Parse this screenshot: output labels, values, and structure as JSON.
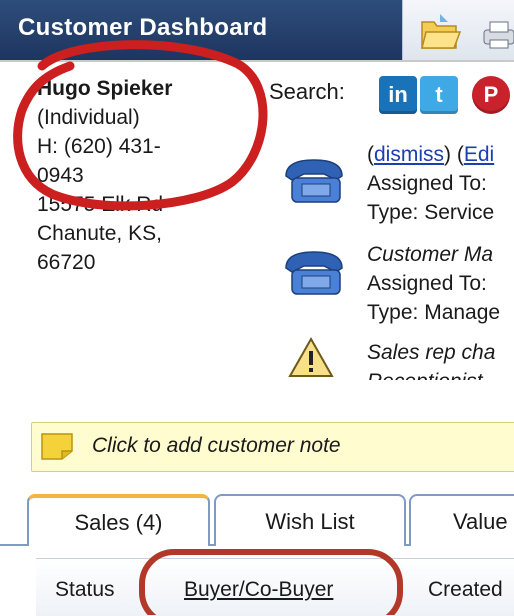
{
  "header": {
    "title": "Customer Dashboard",
    "accent_color": "#1d3560"
  },
  "contact": {
    "name": "Hugo Spieker",
    "type": "(Individual)",
    "phone_line1": "H: (620) 431-",
    "phone_line2": "0943",
    "address1": "15575 Elk Rd",
    "address2": "Chanute, KS,",
    "zip": "66720"
  },
  "search": {
    "label": "Search:",
    "social": [
      {
        "name": "linkedin-icon",
        "glyph": "in",
        "color": "#1a73b8"
      },
      {
        "name": "twitter-icon",
        "glyph": "t",
        "color": "#3fa9e6"
      },
      {
        "name": "pinterest-icon",
        "glyph": "P",
        "color": "#c8232c"
      }
    ]
  },
  "feed": [
    {
      "icon": "phone-icon",
      "line1_links": [
        "dismiss",
        "Edi"
      ],
      "line2": "Assigned To:",
      "line3": "Type: Service"
    },
    {
      "icon": "phone-icon",
      "line1": "Customer Ma",
      "line2": "Assigned To:",
      "line3": "Type: Manage"
    },
    {
      "icon": "warning-icon",
      "line1": "Sales rep cha",
      "line2": "Receptionist"
    }
  ],
  "note": {
    "text": "Click to add customer note",
    "icon": "sticky-note-icon"
  },
  "tabs": [
    {
      "label": "Sales (4)",
      "active": true
    },
    {
      "label": "Wish List",
      "active": false
    },
    {
      "label": "Value",
      "active": false
    }
  ],
  "columns": {
    "status": "Status",
    "buyer": "Buyer/Co-Buyer",
    "created": "Created"
  },
  "annotation_color": "#cc1f1f"
}
